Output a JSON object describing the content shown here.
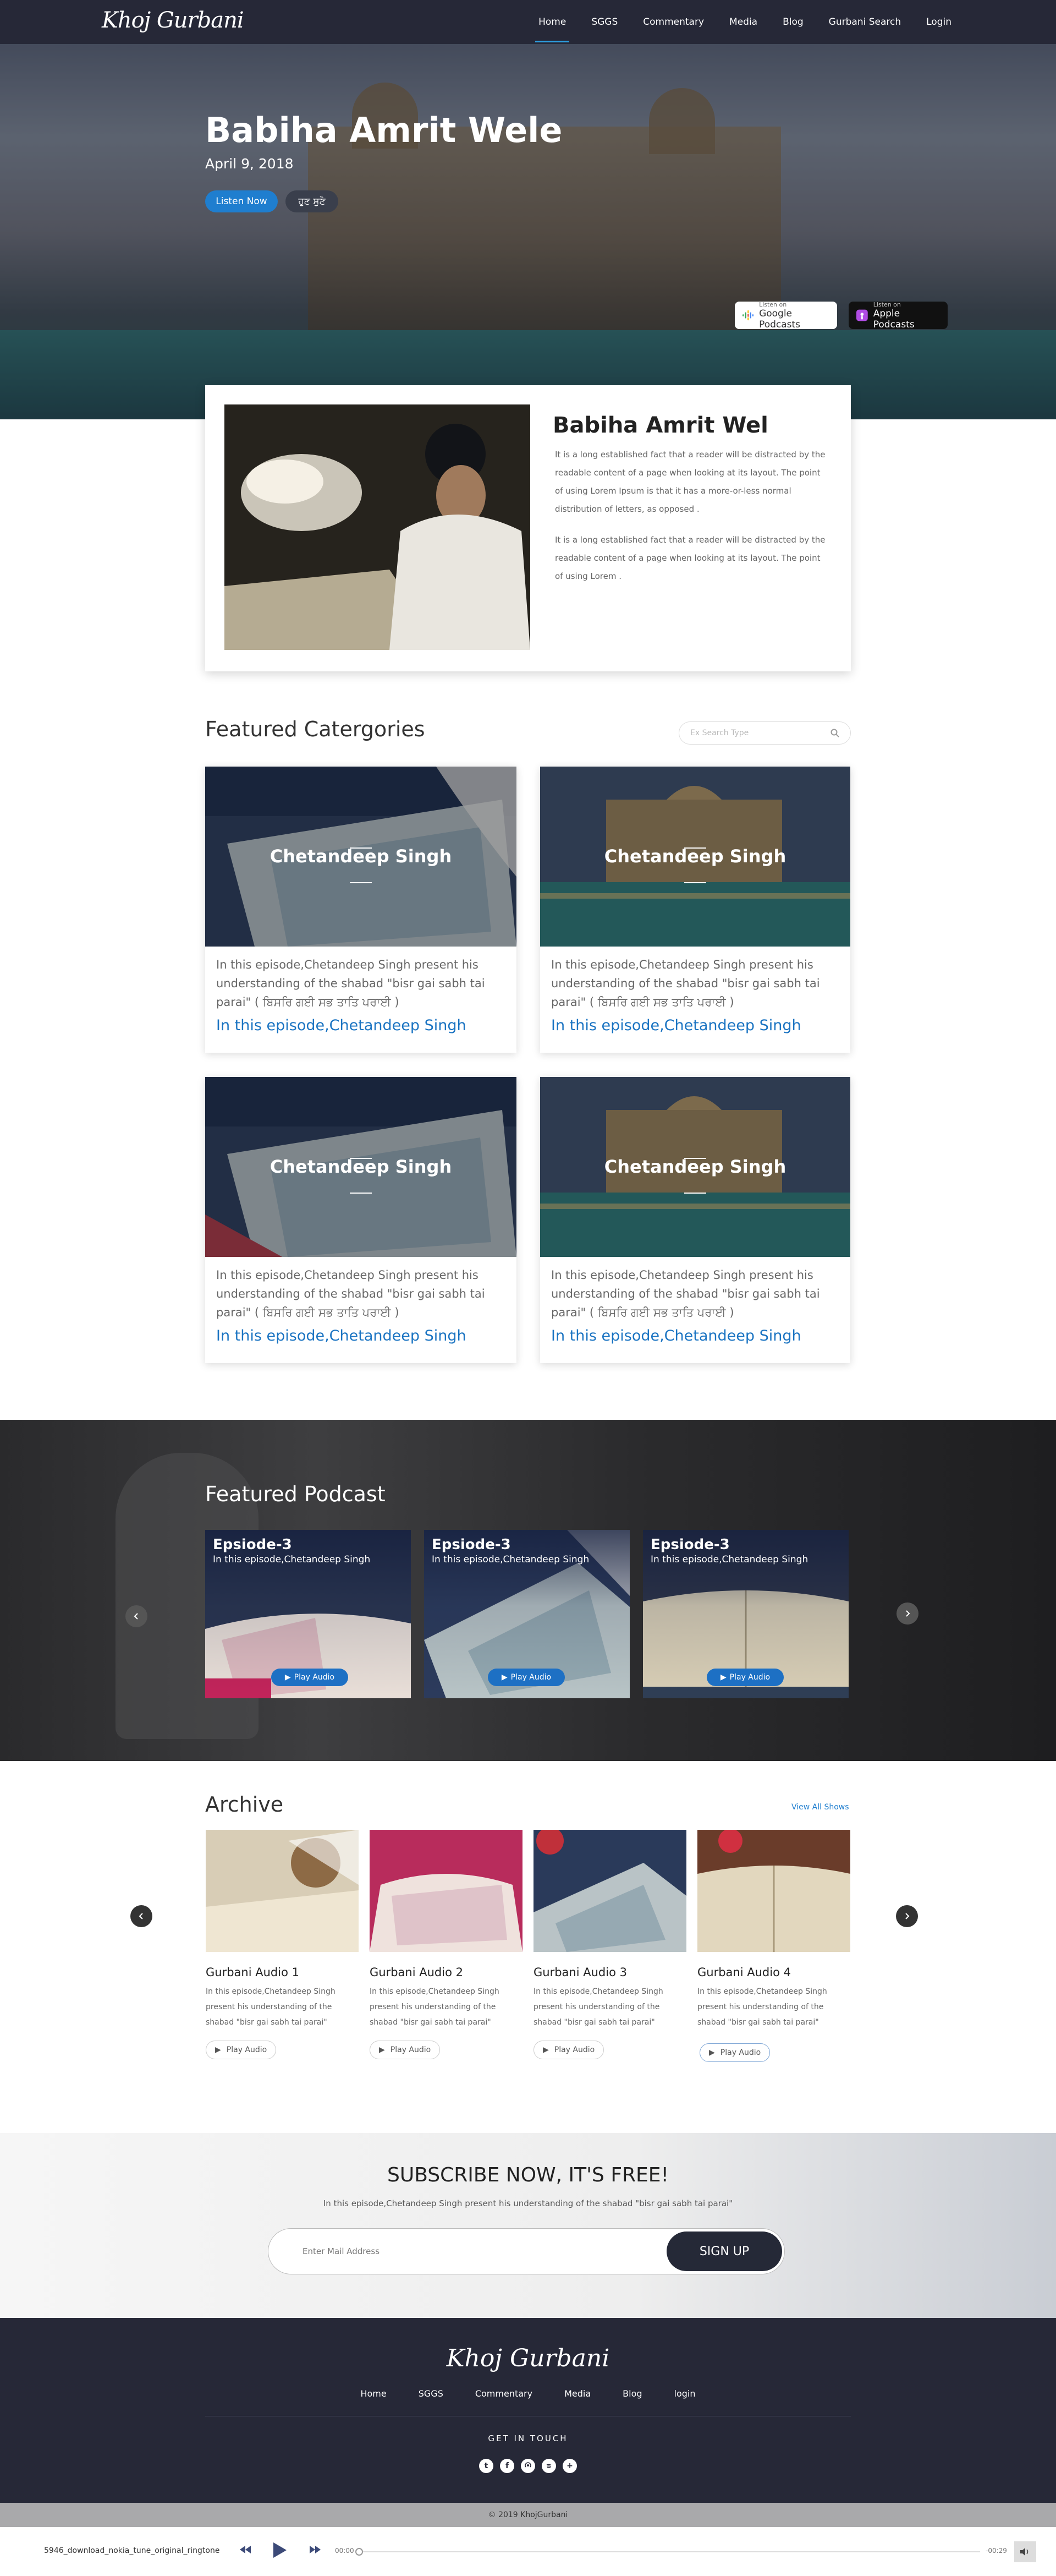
{
  "nav": {
    "logo": "Khoj Gurbani",
    "links": [
      "Home",
      "SGGS",
      "Commentary",
      "Media",
      "Blog",
      "Gurbani Search",
      "Login"
    ]
  },
  "hero": {
    "title": "Babiha Amrit Wele",
    "date": "April 9, 2018",
    "listen_label": "Listen Now",
    "punjabi_label": "ਹੁਣ ਸੁਣੋ",
    "google_badge": {
      "top": "Listen on",
      "main": "Google Podcasts"
    },
    "apple_badge": {
      "top": "Listen on",
      "main": "Apple Podcasts"
    }
  },
  "intro": {
    "title": "Babiha Amrit Wel",
    "p1": "It is a long established fact that a reader will be distracted by the readable content of a page when looking at its layout. The point of using Lorem Ipsum is that it has a more-or-less normal distribution of letters, as opposed .",
    "p2": "It is a long established fact that a reader will be distracted by the readable content of a page when looking at its layout. The point of using Lorem ."
  },
  "categories": {
    "title": "Featured Catergories",
    "search_placeholder": "Ex Search Type",
    "cards": [
      {
        "name": "Chetandeep Singh",
        "text": "In this episode,Chetandeep Singh present his understanding of the shabad \"bisr gai sabh tai parai\" ( ਬਿਸਰਿ ਗਈ ਸਭ ਤਾਤਿ ਪਰਾਈ )",
        "link": "In this episode,Chetandeep Singh"
      },
      {
        "name": "Chetandeep Singh",
        "text": "In this episode,Chetandeep Singh present his understanding of the shabad \"bisr gai sabh tai parai\" ( ਬਿਸਰਿ ਗਈ ਸਭ ਤਾਤਿ ਪਰਾਈ )",
        "link": "In this episode,Chetandeep Singh"
      },
      {
        "name": "Chetandeep Singh",
        "text": "In this episode,Chetandeep Singh present his understanding of the shabad \"bisr gai sabh tai parai\" ( ਬਿਸਰਿ ਗਈ ਸਭ ਤਾਤਿ ਪਰਾਈ )",
        "link": "In this episode,Chetandeep Singh"
      },
      {
        "name": "Chetandeep Singh",
        "text": "In this episode,Chetandeep Singh present his understanding of the shabad \"bisr gai sabh tai parai\" ( ਬਿਸਰਿ ਗਈ ਸਭ ਤਾਤਿ ਪਰਾਈ )",
        "link": "In this episode,Chetandeep Singh"
      }
    ]
  },
  "podcast": {
    "title": "Featured Podcast",
    "cards": [
      {
        "episode": "Epsiode-3",
        "sub": "In this episode,Chetandeep Singh",
        "play": "Play Audio"
      },
      {
        "episode": "Epsiode-3",
        "sub": "In this episode,Chetandeep Singh",
        "play": "Play Audio"
      },
      {
        "episode": "Epsiode-3",
        "sub": "In this episode,Chetandeep Singh",
        "play": "Play Audio"
      }
    ]
  },
  "archive": {
    "title": "Archive",
    "view_all": "View All Shows",
    "items": [
      {
        "title": "Gurbani Audio 1",
        "text": "In this episode,Chetandeep Singh present his understanding of the shabad \"bisr gai sabh tai parai\"",
        "play": "Play Audio"
      },
      {
        "title": "Gurbani Audio 2",
        "text": "In this episode,Chetandeep Singh present his understanding of the shabad \"bisr gai sabh tai parai\"",
        "play": "Play Audio"
      },
      {
        "title": "Gurbani Audio 3",
        "text": "In this episode,Chetandeep Singh present his understanding of the shabad \"bisr gai sabh tai parai\"",
        "play": "Play Audio"
      },
      {
        "title": "Gurbani Audio 4",
        "text": "In this episode,Chetandeep Singh present his understanding of the shabad \"bisr gai sabh tai parai\"",
        "play": "Play Audio"
      }
    ]
  },
  "subscribe": {
    "title": "SUBSCRIBE NOW, IT'S FREE!",
    "text": "In this episode,Chetandeep Singh present his understanding of the shabad \"bisr gai sabh tai parai\"",
    "placeholder": "Enter Mail Address",
    "button": "SIGN UP"
  },
  "footer": {
    "logo": "Khoj Gurbani",
    "links": [
      "Home",
      "SGGS",
      "Commentary",
      "Media",
      "Blog",
      "login"
    ],
    "get_in_touch": "GET IN TOUCH",
    "social_icons": [
      "twitter-icon",
      "facebook-icon",
      "podcast-icon",
      "spotify-icon",
      "plus-icon"
    ],
    "copyright": "© 2019 KhojGurbani"
  },
  "player": {
    "track": "5946_download_nokia_tune_original_ringtone",
    "current_time": "00:00",
    "duration": "-00:29"
  },
  "colors": {
    "nav_bg": "#262837",
    "accent_blue": "#1f7ecf",
    "link_blue": "#1b74c2"
  }
}
